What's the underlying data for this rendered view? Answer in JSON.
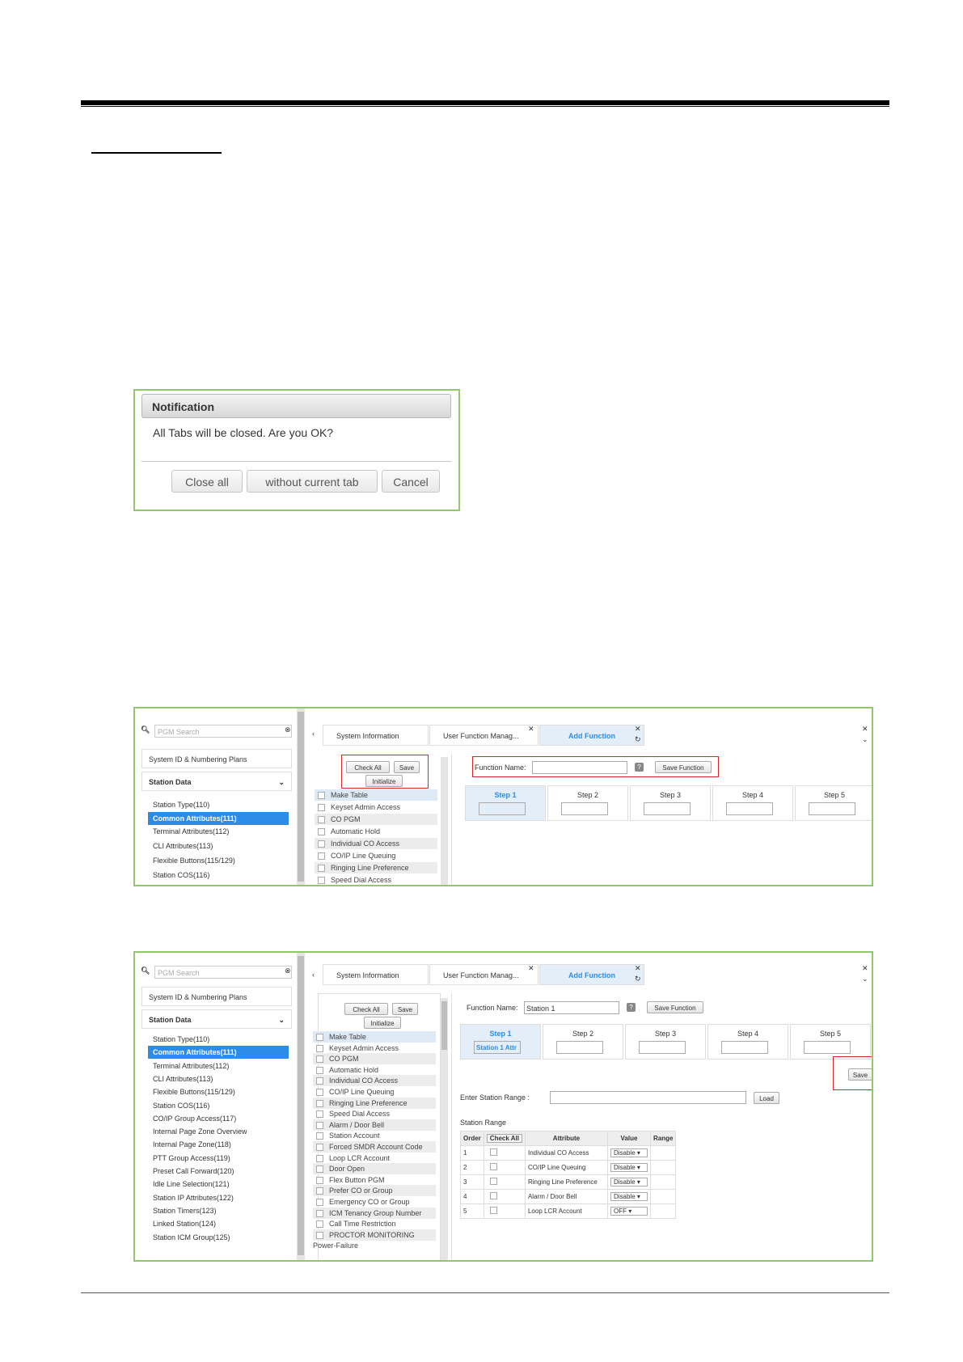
{
  "notification": {
    "title": "Notification",
    "message": "All Tabs will be closed. Are you OK?",
    "buttons": [
      "Close all",
      "without current tab",
      "Cancel"
    ]
  },
  "screen1": {
    "search_placeholder": "PGM Search",
    "sidebar_top": "System ID & Numbering Plans",
    "sidebar_section": "Station Data",
    "sidebar_items": [
      "Station Type(110)",
      "Common Attributes(111)",
      "Terminal Attributes(112)",
      "CLI Attributes(113)",
      "Flexible Buttons(115/129)",
      "Station COS(116)"
    ],
    "tabs": [
      "System Information",
      "User Function Manag...",
      "Add Function"
    ],
    "check_all": "Check All",
    "save": "Save",
    "initialize": "Initialize",
    "functions": [
      "Make Table",
      "Keyset Admin Access",
      "CO PGM",
      "Automatic Hold",
      "Individual CO Access",
      "CO/IP Line Queuing",
      "Ringing Line Preference",
      "Speed Dial Access"
    ],
    "function_name_label": "Function Name:",
    "function_name_value": "",
    "save_function": "Save Function",
    "steps": [
      "Step 1",
      "Step 2",
      "Step 3",
      "Step 4",
      "Step 5"
    ]
  },
  "screen2": {
    "search_placeholder": "PGM Search",
    "sidebar_top": "System ID & Numbering Plans",
    "sidebar_section": "Station Data",
    "sidebar_items": [
      "Station Type(110)",
      "Common Attributes(111)",
      "Terminal Attributes(112)",
      "CLI Attributes(113)",
      "Flexible Buttons(115/129)",
      "Station COS(116)",
      "CO/IP Group Access(117)",
      "Internal Page Zone Overview",
      "Internal Page Zone(118)",
      "PTT Group Access(119)",
      "Preset Call Forward(120)",
      "Idle Line Selection(121)",
      "Station IP Attributes(122)",
      "Station Timers(123)",
      "Linked Station(124)",
      "Station ICM Group(125)"
    ],
    "tabs": [
      "System Information",
      "User Function Manag...",
      "Add Function"
    ],
    "check_all": "Check All",
    "save": "Save",
    "initialize": "Initialize",
    "functions": [
      "Make Table",
      "Keyset Admin Access",
      "CO PGM",
      "Automatic Hold",
      "Individual CO Access",
      "CO/IP Line Queuing",
      "Ringing Line Preference",
      "Speed Dial Access",
      "Alarm / Door Bell",
      "Station Account",
      "Forced SMDR Account Code",
      "Loop LCR Account",
      "Door Open",
      "Flex Button PGM",
      "Prefer CO or Group",
      "Emergency CO or Group",
      "ICM Tenancy Group Number",
      "Call Time Restriction",
      "PROCTOR MONITORING",
      "Power-Failure"
    ],
    "function_name_label": "Function Name:",
    "function_name_value": "Station 1",
    "save_function": "Save Function",
    "steps": [
      "Step 1",
      "Step 2",
      "Step 3",
      "Step 4",
      "Step 5"
    ],
    "step1_value": "Station 1 Attr",
    "save_btn": "Save",
    "station_range_label": "Enter Station Range :",
    "load": "Load",
    "station_range_title": "Station Range",
    "table_headers": [
      "Order",
      "Check All",
      "Attribute",
      "Value",
      "Range"
    ],
    "rows": [
      {
        "order": "1",
        "attribute": "Individual CO Access",
        "value": "Disable"
      },
      {
        "order": "2",
        "attribute": "CO/IP Line Queuing",
        "value": "Disable"
      },
      {
        "order": "3",
        "attribute": "Ringing Line Preference",
        "value": "Disable"
      },
      {
        "order": "4",
        "attribute": "Alarm / Door Bell",
        "value": "Disable"
      },
      {
        "order": "5",
        "attribute": "Loop LCR Account",
        "value": "OFF"
      }
    ]
  }
}
